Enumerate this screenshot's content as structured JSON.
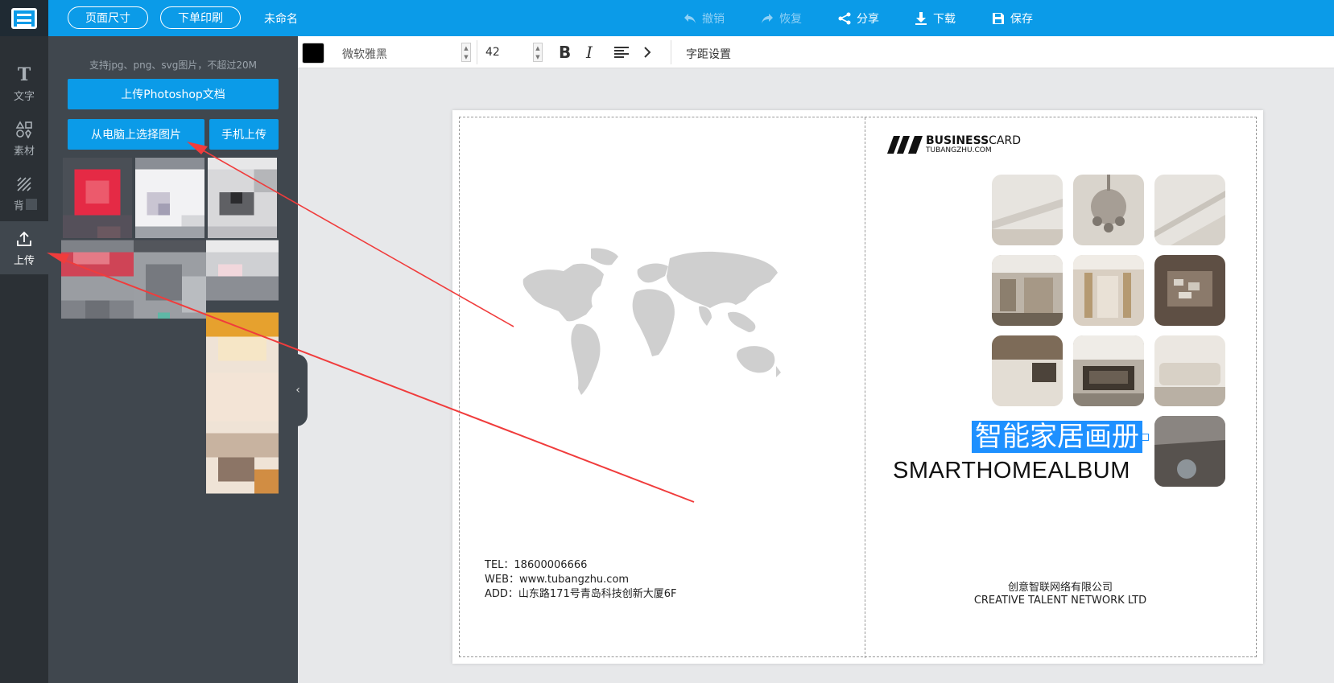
{
  "header": {
    "page_size_label": "页面尺寸",
    "print_order_label": "下单印刷",
    "doc_name": "未命名",
    "undo_label": "撤销",
    "redo_label": "恢复",
    "share_label": "分享",
    "download_label": "下载",
    "save_label": "保存"
  },
  "rail": {
    "items": [
      {
        "label": "文字",
        "icon": "text-icon"
      },
      {
        "label": "素材",
        "icon": "shapes-icon"
      },
      {
        "label": "背景",
        "icon": "pattern-icon"
      },
      {
        "label": "上传",
        "icon": "upload-icon"
      }
    ]
  },
  "panel": {
    "hint": "支持jpg、png、svg图片，不超过20M",
    "upload_psd_label": "上传Photoshop文档",
    "select_pc_label": "从电脑上选择图片",
    "phone_upload_label": "手机上传"
  },
  "format_toolbar": {
    "color": "#000000",
    "font": "微软雅黑",
    "size": "42",
    "spacing_label": "字距设置"
  },
  "canvas": {
    "contact": {
      "tel": "TEL：18600006666",
      "web": "WEB：www.tubangzhu.com",
      "addr": "ADD：山东路171号青岛科技创新大厦6F"
    },
    "brand": {
      "bold": "BUSINESS",
      "normal": "CARD",
      "sub": "TUBANGZHU.COM"
    },
    "title_cn": "智能家居画册",
    "title_en": "SMARTHOMEALBUM",
    "company_cn": "创意智联网络有限公司",
    "company_en": "CREATIVE TALENT NETWORK LTD"
  },
  "colors": {
    "accent": "#0b9be8",
    "rail_bg": "#2b3035",
    "panel_bg": "#40474e",
    "selection": "#1e90ff",
    "arrow": "#f03c3c"
  }
}
